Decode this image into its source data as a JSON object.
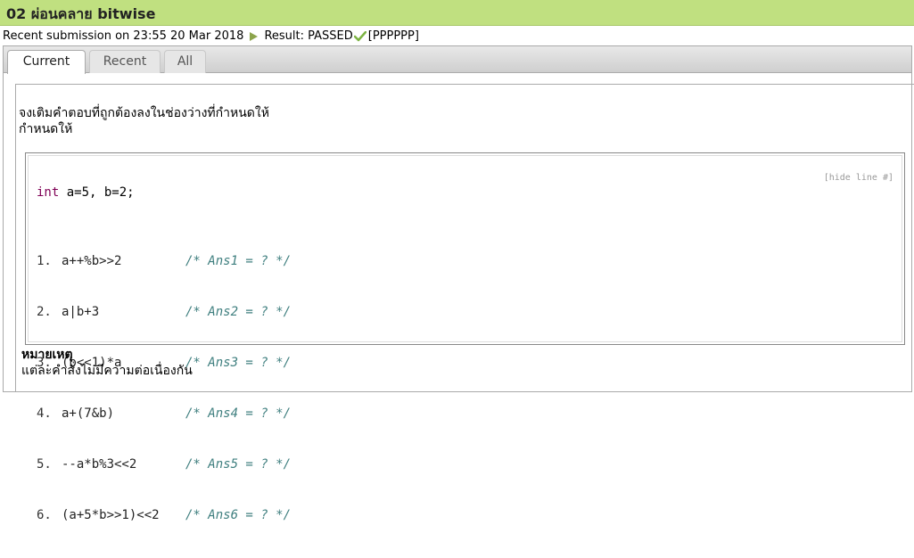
{
  "title": "02 ผ่อนคลาย bitwise",
  "submission": {
    "prefix": "Recent submission on 23:55 20 Mar 2018",
    "result_label": "Result: PASSED",
    "result_detail": "[PPPPPP]"
  },
  "tabs": [
    {
      "label": "Current",
      "active": true
    },
    {
      "label": "Recent",
      "active": false
    },
    {
      "label": "All",
      "active": false
    }
  ],
  "instructions": {
    "line1": "จงเติมคำตอบที่ถูกต้องลงในช่องว่างที่กำหนดให้",
    "line2": "กำหนดให้"
  },
  "code": {
    "hide_line_label": "[hide line #]",
    "decl_keyword": "int",
    "decl_rest": " a=5, b=2;",
    "lines": [
      {
        "num": "1.",
        "expr": "a++%b>>2",
        "comment": "/* Ans1 = ? */"
      },
      {
        "num": "2.",
        "expr": "a|b+3",
        "comment": "/* Ans2 = ? */"
      },
      {
        "num": "3.",
        "expr": "(b<<1)*a",
        "comment": "/* Ans3 = ? */"
      },
      {
        "num": "4.",
        "expr": "a+(7&b)",
        "comment": "/* Ans4 = ? */"
      },
      {
        "num": "5.",
        "expr": "--a*b%3<<2",
        "comment": "/* Ans5 = ? */"
      },
      {
        "num": "6.",
        "expr": "(a+5*b>>1)<<2",
        "comment": "/* Ans6 = ? */"
      }
    ]
  },
  "note": {
    "title": "หมายเหตุ",
    "text": "แต่ละคำสั่งไม่มีความต่อเนื่องกัน"
  },
  "colors": {
    "title_bar": "#c0e080",
    "comment": "#3f7f7f",
    "keyword": "#7f0055"
  }
}
